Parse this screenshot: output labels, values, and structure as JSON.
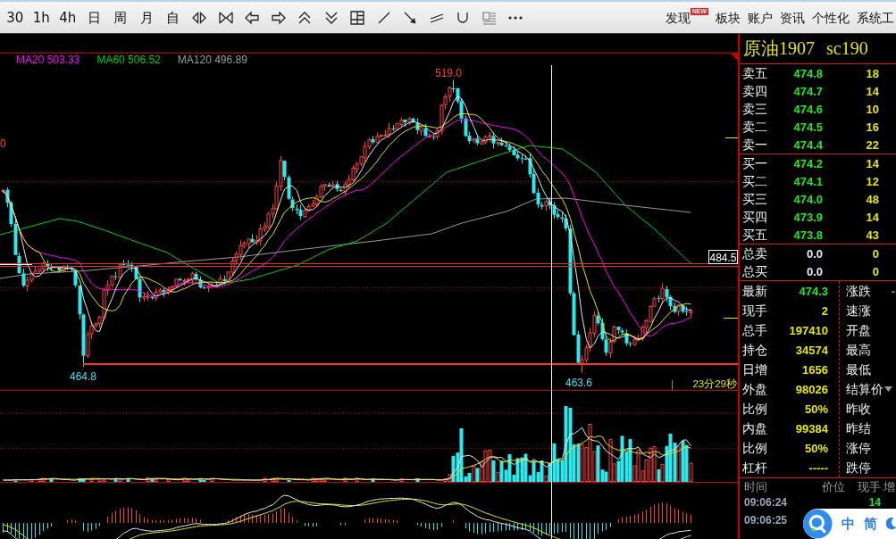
{
  "toolbar": {
    "periods": [
      "30",
      "1h",
      "4h",
      "日",
      "周",
      "月",
      "自"
    ],
    "menu": [
      {
        "label": "发现",
        "badge": "NEW"
      },
      {
        "label": "板块"
      },
      {
        "label": "账户"
      },
      {
        "label": "资讯"
      },
      {
        "label": "个性化"
      },
      {
        "label": "系统工"
      }
    ]
  },
  "chart": {
    "legend": [
      {
        "label": "MA20 503.33",
        "color": "#ff00ff"
      },
      {
        "label": "MA60 506.52",
        "color": "#00d000"
      },
      {
        "label": "MA120 496.89",
        "color": "#9a9a9a"
      }
    ],
    "high_label": "519.0",
    "low_labels": [
      "464.8",
      "463.6"
    ],
    "edge_label": "0",
    "price_tag": "484.5",
    "countdown": "23分29秒"
  },
  "quote": {
    "name": "原油1907",
    "code": "sc190",
    "asks": [
      {
        "label": "卖五",
        "price": "474.8",
        "volume": "18"
      },
      {
        "label": "卖四",
        "price": "474.7",
        "volume": "14"
      },
      {
        "label": "卖三",
        "price": "474.6",
        "volume": "10"
      },
      {
        "label": "卖二",
        "price": "474.5",
        "volume": "16"
      },
      {
        "label": "卖一",
        "price": "474.4",
        "volume": "22"
      }
    ],
    "bids": [
      {
        "label": "买一",
        "price": "474.2",
        "volume": "14"
      },
      {
        "label": "买二",
        "price": "474.1",
        "volume": "12"
      },
      {
        "label": "买三",
        "price": "474.0",
        "volume": "48"
      },
      {
        "label": "买四",
        "price": "473.9",
        "volume": "14"
      },
      {
        "label": "买五",
        "price": "473.8",
        "volume": "43"
      }
    ],
    "totals": [
      {
        "label": "总卖",
        "price": "0.0",
        "volume": "0"
      },
      {
        "label": "总买",
        "price": "0.0",
        "volume": "0"
      }
    ],
    "stats_left": [
      {
        "label": "最新",
        "value": "474.3",
        "color": "#22e622"
      },
      {
        "label": "现手",
        "value": "2",
        "color": "#e6e600"
      },
      {
        "label": "总手",
        "value": "197410",
        "color": "#e6e600"
      },
      {
        "label": "持仓",
        "value": "34574",
        "color": "#e6e600"
      },
      {
        "label": "日增",
        "value": "1656",
        "color": "#e6e600"
      },
      {
        "label": "外盘",
        "value": "98026",
        "color": "#e6e600"
      },
      {
        "label": "比例",
        "value": "50%",
        "color": "#e6e600"
      },
      {
        "label": "内盘",
        "value": "99384",
        "color": "#e6e600"
      },
      {
        "label": "比例",
        "value": "50%",
        "color": "#e6e600"
      },
      {
        "label": "杠杆",
        "value": "-----",
        "color": "#e6e600"
      }
    ],
    "stats_right": [
      {
        "label": "涨跌",
        "value": "-",
        "dropdown": false
      },
      {
        "label": "速涨",
        "dropdown": false
      },
      {
        "label": "开盘",
        "dropdown": false
      },
      {
        "label": "最高",
        "dropdown": false
      },
      {
        "label": "最低",
        "dropdown": false
      },
      {
        "label": "结算价",
        "dropdown": true
      },
      {
        "label": "昨收",
        "dropdown": false
      },
      {
        "label": "昨结",
        "dropdown": false
      },
      {
        "label": "涨停",
        "dropdown": false
      },
      {
        "label": "跌停",
        "dropdown": false
      }
    ]
  },
  "ticks": {
    "columns": [
      "时间",
      "价位",
      "现手",
      "增"
    ],
    "rows": [
      {
        "time": "09:06:24",
        "volume": "14"
      },
      {
        "time": "09:06:25"
      }
    ]
  },
  "ime_bar": {
    "mode": "中",
    "script": "简"
  }
}
